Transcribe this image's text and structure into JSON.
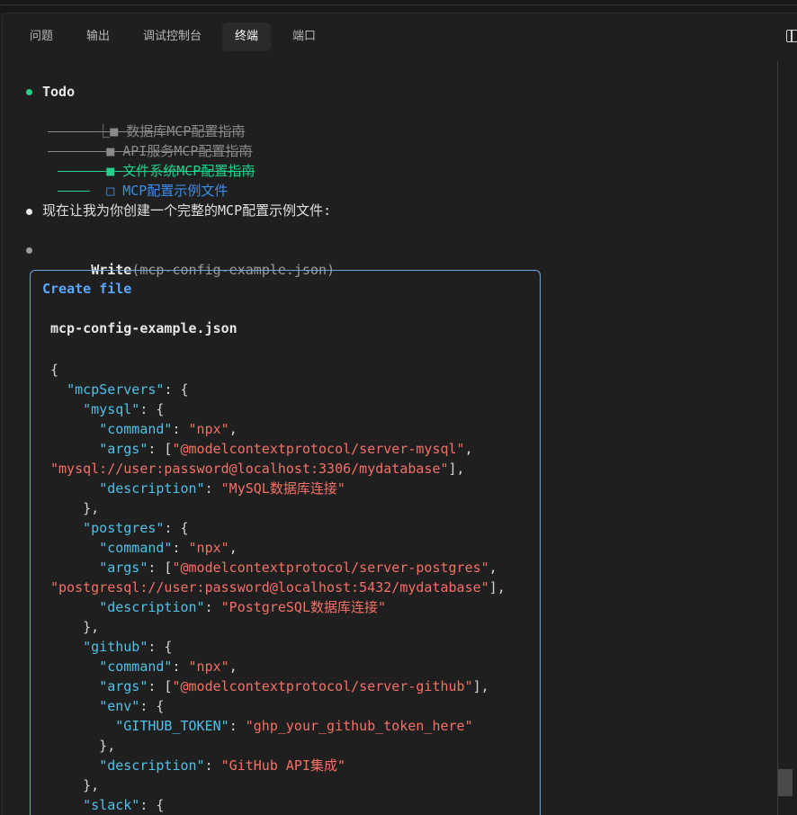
{
  "tabs": [
    "问题",
    "输出",
    "调试控制台",
    "终端",
    "端口"
  ],
  "active_tab": "终端",
  "todo": {
    "title": "Todo",
    "tree_prefix": "⎿",
    "items": [
      {
        "marker": "■",
        "text": "数据库MCP配置指南",
        "state": "done"
      },
      {
        "marker": "■",
        "text": "API服务MCP配置指南",
        "state": "done"
      },
      {
        "marker": "■",
        "text": "文件系统MCP配置指南",
        "state": "done-recent"
      },
      {
        "marker": "□",
        "text": "MCP配置示例文件",
        "state": "pending"
      }
    ]
  },
  "message": "现在让我为你创建一个完整的MCP配置示例文件:",
  "tool_call": {
    "name": "Write",
    "args": "(mcp-config-example.json)"
  },
  "create_box": {
    "title": "Create file",
    "filename": "mcp-config-example.json",
    "code_lines": [
      [
        [
          "p",
          "{"
        ]
      ],
      [
        [
          "p",
          "  "
        ],
        [
          "k",
          "\"mcpServers\""
        ],
        [
          "p",
          ": {"
        ]
      ],
      [
        [
          "p",
          "    "
        ],
        [
          "k",
          "\"mysql\""
        ],
        [
          "p",
          ": {"
        ]
      ],
      [
        [
          "p",
          "      "
        ],
        [
          "k",
          "\"command\""
        ],
        [
          "p",
          ": "
        ],
        [
          "s",
          "\"npx\""
        ],
        [
          "p",
          ","
        ]
      ],
      [
        [
          "p",
          "      "
        ],
        [
          "k",
          "\"args\""
        ],
        [
          "p",
          ": ["
        ],
        [
          "s",
          "\"@modelcontextprotocol/server-mysql\""
        ],
        [
          "p",
          ","
        ]
      ],
      [
        [
          "s",
          "\"mysql://user:password@localhost:3306/mydatabase\""
        ],
        [
          "p",
          "],"
        ]
      ],
      [
        [
          "p",
          "      "
        ],
        [
          "k",
          "\"description\""
        ],
        [
          "p",
          ": "
        ],
        [
          "s",
          "\"MySQL数据库连接\""
        ]
      ],
      [
        [
          "p",
          "    },"
        ]
      ],
      [
        [
          "p",
          "    "
        ],
        [
          "k",
          "\"postgres\""
        ],
        [
          "p",
          ": {"
        ]
      ],
      [
        [
          "p",
          "      "
        ],
        [
          "k",
          "\"command\""
        ],
        [
          "p",
          ": "
        ],
        [
          "s",
          "\"npx\""
        ],
        [
          "p",
          ","
        ]
      ],
      [
        [
          "p",
          "      "
        ],
        [
          "k",
          "\"args\""
        ],
        [
          "p",
          ": ["
        ],
        [
          "s",
          "\"@modelcontextprotocol/server-postgres\""
        ],
        [
          "p",
          ","
        ]
      ],
      [
        [
          "s",
          "\"postgresql://user:password@localhost:5432/mydatabase\""
        ],
        [
          "p",
          "],"
        ]
      ],
      [
        [
          "p",
          "      "
        ],
        [
          "k",
          "\"description\""
        ],
        [
          "p",
          ": "
        ],
        [
          "s",
          "\"PostgreSQL数据库连接\""
        ]
      ],
      [
        [
          "p",
          "    },"
        ]
      ],
      [
        [
          "p",
          "    "
        ],
        [
          "k",
          "\"github\""
        ],
        [
          "p",
          ": {"
        ]
      ],
      [
        [
          "p",
          "      "
        ],
        [
          "k",
          "\"command\""
        ],
        [
          "p",
          ": "
        ],
        [
          "s",
          "\"npx\""
        ],
        [
          "p",
          ","
        ]
      ],
      [
        [
          "p",
          "      "
        ],
        [
          "k",
          "\"args\""
        ],
        [
          "p",
          ": ["
        ],
        [
          "s",
          "\"@modelcontextprotocol/server-github\""
        ],
        [
          "p",
          "],"
        ]
      ],
      [
        [
          "p",
          "      "
        ],
        [
          "k",
          "\"env\""
        ],
        [
          "p",
          ": {"
        ]
      ],
      [
        [
          "p",
          "        "
        ],
        [
          "k",
          "\"GITHUB_TOKEN\""
        ],
        [
          "p",
          ": "
        ],
        [
          "s",
          "\"ghp_your_github_token_here\""
        ]
      ],
      [
        [
          "p",
          "      },"
        ]
      ],
      [
        [
          "p",
          "      "
        ],
        [
          "k",
          "\"description\""
        ],
        [
          "p",
          ": "
        ],
        [
          "s",
          "\"GitHub API集成\""
        ]
      ],
      [
        [
          "p",
          "    },"
        ]
      ],
      [
        [
          "p",
          "    "
        ],
        [
          "k",
          "\"slack\""
        ],
        [
          "p",
          ": {"
        ]
      ]
    ]
  },
  "colors": {
    "accent_green": "#23d18b",
    "accent_blue": "#3b8eea",
    "json_key": "#4fc1e9",
    "json_string": "#f47067",
    "box_border": "#6aa7e0"
  }
}
